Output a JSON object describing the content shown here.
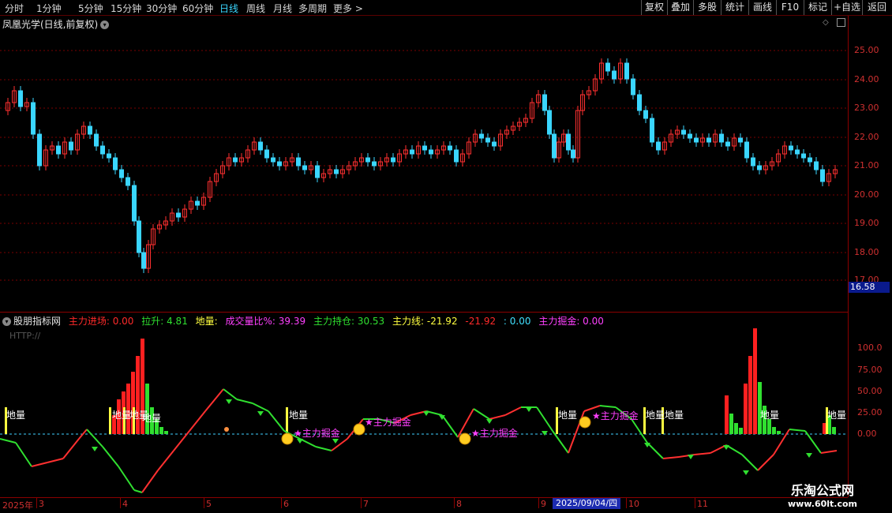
{
  "toolbar": {
    "periods": [
      "分时",
      "1分钟",
      "5分钟",
      "15分钟",
      "30分钟",
      "60分钟",
      "日线",
      "周线",
      "月线",
      "多周期",
      "更多 >"
    ],
    "active": "日线",
    "right_buttons": [
      "复权",
      "叠加",
      "多股",
      "统计",
      "画线",
      "F10",
      "标记",
      "+自选",
      "返回"
    ]
  },
  "stock": {
    "title": "凤凰光学(日线,前复权)"
  },
  "price_axis": {
    "ticks": [
      "25.00",
      "24.00",
      "23.00",
      "22.00",
      "21.00",
      "20.00",
      "19.00",
      "18.00",
      "17.00"
    ],
    "current_tag": "16.58"
  },
  "indicator": {
    "name": "股朋指标网",
    "items": [
      {
        "label": "主力进场: 0.00",
        "color": "#ff2a2a"
      },
      {
        "label": "拉升: 4.81",
        "color": "#30e030"
      },
      {
        "label": "地量:",
        "color": "#ffff40"
      },
      {
        "label": "成交量比%: 39.39",
        "color": "#ff40ff"
      },
      {
        "label": "主力持仓: 30.53",
        "color": "#30e030"
      },
      {
        "label": "主力线: -21.92",
        "color": "#ffff40"
      },
      {
        "label": "-21.92",
        "color": "#ff2a2a"
      },
      {
        "label": ": 0.00",
        "color": "#40e0ff"
      },
      {
        "label": "主力掘金: 0.00",
        "color": "#ff40ff"
      }
    ],
    "http": "HTTP://",
    "ticks": [
      "100.0",
      "75.00",
      "50.00",
      "25.00",
      "0.00"
    ],
    "marker_dili": "地量",
    "marker_juejin": "主力掘金"
  },
  "date_axis": {
    "labels": [
      "2025年",
      "3",
      "4",
      "5",
      "6",
      "7",
      "8",
      "9",
      "10",
      "11"
    ],
    "cursor": "2025/09/04/四"
  },
  "watermark": {
    "line1": "乐淘公式网",
    "line2": "www.60lt.com"
  },
  "colors": {
    "up": "#ff3030",
    "down": "#3ad6ff",
    "green": "#30e030",
    "yellow": "#ffff40",
    "magenta": "#ff40ff"
  }
}
